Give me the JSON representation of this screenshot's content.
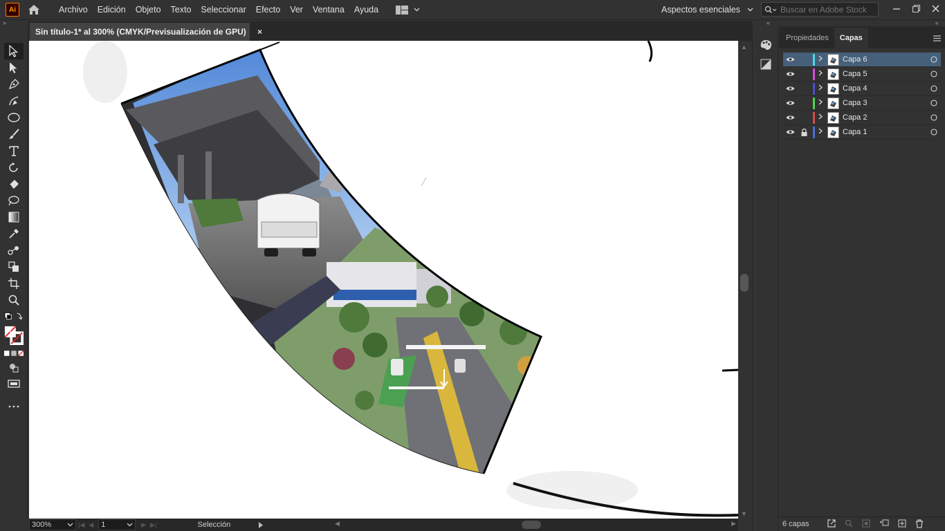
{
  "app": {
    "logo": "Ai"
  },
  "menu": [
    "Archivo",
    "Edición",
    "Objeto",
    "Texto",
    "Seleccionar",
    "Efecto",
    "Ver",
    "Ventana",
    "Ayuda"
  ],
  "workspace": {
    "label": "Aspectos esenciales"
  },
  "stock_search": {
    "placeholder": "Buscar en Adobe Stock"
  },
  "document": {
    "tab_title": "Sin título-1* al 300% (CMYK/Previsualización de GPU)",
    "close_glyph": "×"
  },
  "statusbar": {
    "zoom": "300%",
    "artboard": "1",
    "tool": "Selección"
  },
  "panel": {
    "tabs": [
      "Propiedades",
      "Capas"
    ],
    "active_tab": "Capas",
    "layers": [
      {
        "name": "Capa 6",
        "color": "#4bd7e6",
        "locked": false,
        "selected": true
      },
      {
        "name": "Capa 5",
        "color": "#d64bd7",
        "locked": false,
        "selected": false
      },
      {
        "name": "Capa 4",
        "color": "#4b4bd7",
        "locked": false,
        "selected": false
      },
      {
        "name": "Capa 3",
        "color": "#4bd74b",
        "locked": false,
        "selected": false
      },
      {
        "name": "Capa 2",
        "color": "#d74b4b",
        "locked": false,
        "selected": false
      },
      {
        "name": "Capa 1",
        "color": "#4b6bd7",
        "locked": true,
        "selected": false
      }
    ],
    "footer_count": "6 capas"
  },
  "colors": {
    "ui_bg": "#323232",
    "canvas": "#ffffff",
    "selection": "#46607a",
    "accent_logo": "#ff9a00"
  }
}
